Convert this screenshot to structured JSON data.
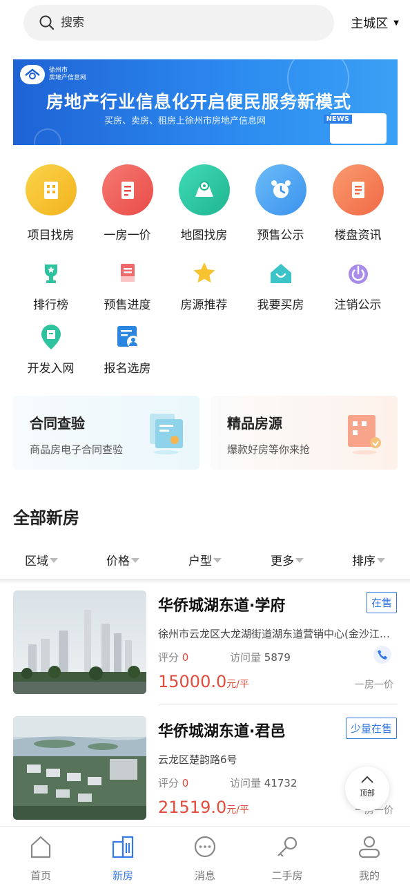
{
  "search": {
    "placeholder": "搜索",
    "icon": "search-icon"
  },
  "city_selector": {
    "label": "主城区",
    "icon": "caret-down-icon"
  },
  "banner": {
    "logo_line1": "徐州市",
    "logo_line2": "房地产信息网",
    "headline": "房地产行业信息化开启便民服务新模式",
    "subline": "买房、卖房、租房上徐州市房地产信息网",
    "news_tag": "NEWS"
  },
  "main_menu": [
    {
      "label": "项目找房",
      "color": "#f5c02b"
    },
    {
      "label": "一房一价",
      "color": "#f0605b"
    },
    {
      "label": "地图找房",
      "color": "#2ec7a4"
    },
    {
      "label": "预售公示",
      "color": "#4ea6f3"
    },
    {
      "label": "楼盘资讯",
      "color": "#f5825a"
    }
  ],
  "sub_menu": [
    {
      "label": "排行榜",
      "icon": "trophy-icon"
    },
    {
      "label": "预售进度",
      "icon": "document-icon"
    },
    {
      "label": "房源推荐",
      "icon": "star-icon"
    },
    {
      "label": "我要买房",
      "icon": "house-icon"
    },
    {
      "label": "注销公示",
      "icon": "power-icon"
    },
    {
      "label": "开发入网",
      "icon": "map-pin-icon"
    },
    {
      "label": "报名选房",
      "icon": "user-form-icon"
    }
  ],
  "cards": [
    {
      "title": "合同查验",
      "subtitle": "商品房电子合同查验"
    },
    {
      "title": "精品房源",
      "subtitle": "爆款好房等你来抢"
    }
  ],
  "section": {
    "title": "全部新房"
  },
  "filters": [
    "区域",
    "价格",
    "户型",
    "更多",
    "排序"
  ],
  "listings": [
    {
      "name": "华侨城湖东道·学府",
      "status": "在售",
      "address": "徐州市云龙区大龙湖街道湖东道营销中心(金沙江路与创业路交汇处)",
      "score_label": "评分",
      "score": "0",
      "visits_label": "访问量",
      "visits": "5879",
      "price": "15000.0",
      "unit": "元/平",
      "tag": "一房一价"
    },
    {
      "name": "华侨城湖东道·君邑",
      "status": "少量在售",
      "address": "云龙区楚韵路6号",
      "score_label": "评分",
      "score": "0",
      "visits_label": "访问量",
      "visits": "41732",
      "price": "21519.0",
      "unit": "元/平",
      "tag": "一房一价"
    }
  ],
  "back_to_top": {
    "label": "顶部"
  },
  "bottom_nav": [
    {
      "label": "首页",
      "icon": "home-icon",
      "active": false
    },
    {
      "label": "新房",
      "icon": "building-icon",
      "active": true
    },
    {
      "label": "消息",
      "icon": "chat-icon",
      "active": false
    },
    {
      "label": "二手房",
      "icon": "key-icon",
      "active": false
    },
    {
      "label": "我的",
      "icon": "user-icon",
      "active": false
    }
  ]
}
